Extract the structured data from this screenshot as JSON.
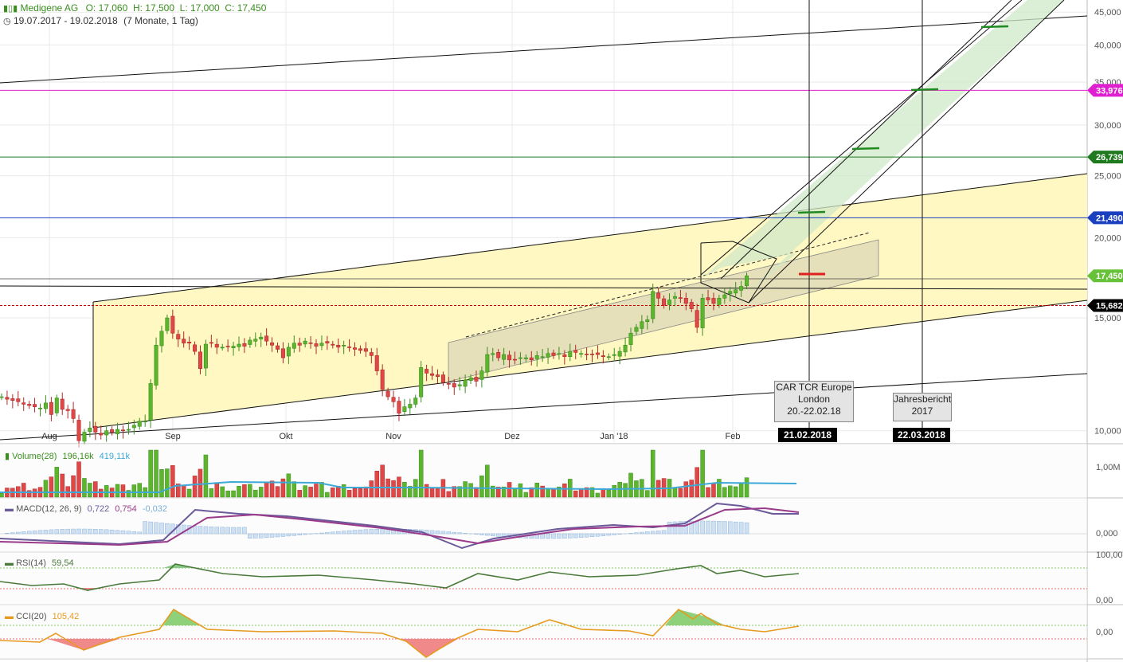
{
  "header": {
    "symbol": "Medigene AG",
    "ohlc": "O: 17,060  H: 17,500  L: 17,000  C: 17,450",
    "range": "19.07.2017 - 19.02.2018",
    "period": "(7 Monate, 1 Tag)"
  },
  "price_axis": {
    "ticks": [
      "45,000",
      "40,000",
      "35,000",
      "30,000",
      "25,000",
      "20,000",
      "15,000",
      "10,000"
    ],
    "tick_values": [
      45,
      40,
      35,
      30,
      25,
      20,
      15,
      10
    ],
    "scale": "log"
  },
  "time_axis": {
    "labels": [
      "Aug",
      "Sep",
      "Okt",
      "Nov",
      "Dez",
      "Jan '18",
      "Feb"
    ]
  },
  "price_tags": [
    {
      "label": "33,976",
      "value": 33.976,
      "color": "#e01fd0"
    },
    {
      "label": "26,739",
      "value": 26.739,
      "color": "#1f7a1f"
    },
    {
      "label": "21,490",
      "value": 21.49,
      "color": "#1a3fbf"
    },
    {
      "label": "17,450",
      "value": 17.45,
      "color": "#67c23a"
    },
    {
      "label": "15,682",
      "value": 15.682,
      "color": "#000000"
    }
  ],
  "annotations": [
    {
      "text_lines": [
        "CAR TCR Europe",
        "London",
        "20.-22.02.18"
      ],
      "date_flag": "21.02.2018"
    },
    {
      "text_lines": [
        "Jahresbericht",
        "2017"
      ],
      "date_flag": "22.03.2018"
    }
  ],
  "indicators": {
    "volume": {
      "name": "Volume(28)",
      "v1": "196,16k",
      "v2": "419,11k",
      "tick": "1,00M"
    },
    "macd": {
      "name": "MACD(12, 26, 9)",
      "v1": "0,722",
      "v2": "0,754",
      "v3": "-0,032",
      "tick": "0,000"
    },
    "rsi": {
      "name": "RSI(14)",
      "v1": "59,54",
      "tick_top": "100,00",
      "tick_bottom": "0,00"
    },
    "cci": {
      "name": "CCI(20)",
      "v1": "105,42",
      "tick": "0,00"
    }
  },
  "colors": {
    "up": "#5cb52d",
    "down": "#e04848",
    "channel_fill": "#fff8c2",
    "green_channel": "#cfe8c8",
    "sma_volume": "#3da9d6",
    "macd_line": "#6a5a9a",
    "signal_line": "#9a3a8a",
    "rsi_line": "#4a7a3a",
    "cci_line": "#e69a1f"
  },
  "chart_data": {
    "type": "candlestick",
    "title": "Medigene AG",
    "ylim": [
      9.6,
      47
    ],
    "yscale": "log",
    "x_start": "2017-07-19",
    "x_end": "2018-02-19",
    "closes": [
      11.3,
      11.2,
      11.15,
      11.1,
      11.0,
      10.95,
      10.9,
      10.85,
      11.05,
      10.6,
      11.25,
      10.8,
      10.75,
      10.45,
      9.65,
      9.95,
      10.1,
      9.95,
      9.85,
      10.0,
      9.95,
      10.05,
      10.0,
      10.05,
      10.2,
      10.35,
      10.35,
      11.85,
      13.6,
      14.3,
      15.0,
      14.2,
      13.9,
      13.7,
      13.7,
      13.3,
      12.5,
      13.65,
      13.7,
      13.5,
      13.5,
      13.55,
      13.55,
      13.65,
      13.55,
      13.85,
      13.9,
      14.0,
      13.8,
      13.6,
      13.4,
      13.0,
      13.5,
      13.7,
      13.6,
      13.8,
      13.7,
      13.55,
      13.7,
      13.7,
      13.6,
      13.5,
      13.6,
      13.5,
      13.4,
      13.35,
      13.3,
      13.1,
      12.4,
      11.6,
      11.3,
      11.1,
      10.65,
      10.9,
      11.0,
      11.25,
      12.55,
      12.3,
      12.2,
      12.15,
      11.9,
      11.85,
      11.7,
      11.8,
      12.0,
      12.1,
      11.95,
      12.4,
      13.15,
      13.2,
      13.0,
      13.15,
      12.9,
      12.9,
      13.0,
      13.0,
      12.9,
      13.1,
      13.05,
      13.2,
      13.1,
      13.2,
      13.05,
      13.3,
      13.25,
      13.2,
      13.15,
      13.15,
      13.15,
      13.05,
      13.05,
      13.15,
      13.3,
      13.6,
      14.2,
      14.5,
      14.8,
      14.9,
      16.5,
      16.1,
      15.7,
      16.0,
      16.2,
      16.1,
      15.8,
      15.5,
      14.5,
      16.1,
      16.0,
      15.8,
      16.1,
      16.3,
      16.5,
      16.6,
      16.8,
      17.45
    ],
    "volume_sma_current": "196,16k",
    "levels": [
      33.976,
      26.739,
      21.49,
      17.45,
      15.682
    ],
    "event_dates": [
      "21.02.2018",
      "22.03.2018"
    ]
  }
}
